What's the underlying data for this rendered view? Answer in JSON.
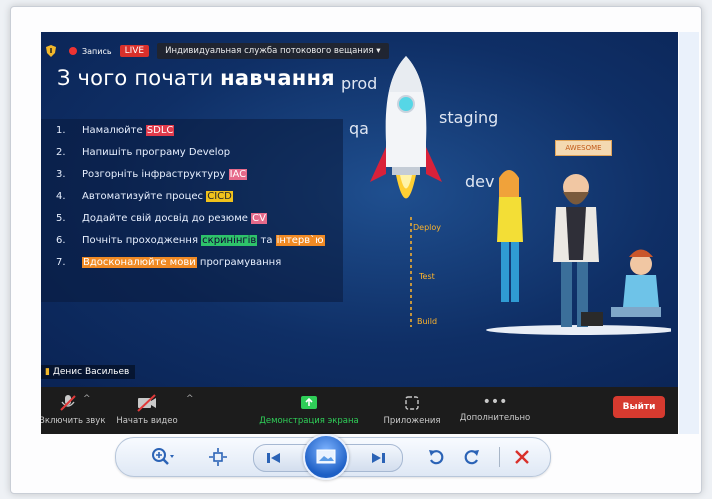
{
  "meeting": {
    "recording_label": "Запись",
    "live_label": "LIVE",
    "service_label": "Индивидуальная служба потокового вещания",
    "participant_name": "Денис Васильев"
  },
  "slide": {
    "title_plain": "З чого почати ",
    "title_bold": "навчання",
    "steps": [
      {
        "num": "1.",
        "parts": [
          {
            "t": "Намалюйте "
          },
          {
            "t": "SDLC",
            "hl": "red"
          }
        ]
      },
      {
        "num": "2.",
        "parts": [
          {
            "t": "Напишіть програму Develop"
          }
        ]
      },
      {
        "num": "3.",
        "parts": [
          {
            "t": "Розгорніть інфраструктуру "
          },
          {
            "t": "IAC",
            "hl": "pink"
          }
        ]
      },
      {
        "num": "4.",
        "parts": [
          {
            "t": "Автоматизуйте процес "
          },
          {
            "t": "CICD",
            "hl": "yellow"
          }
        ]
      },
      {
        "num": "5.",
        "parts": [
          {
            "t": "Додайте свій досвід до резюме "
          },
          {
            "t": "CV",
            "hl": "pink"
          }
        ]
      },
      {
        "num": "6.",
        "parts": [
          {
            "t": "Почніть проходження "
          },
          {
            "t": "скринінгів",
            "hl": "green"
          },
          {
            "t": " та "
          },
          {
            "t": "інтерв`ю",
            "hl": "orange"
          }
        ]
      },
      {
        "num": "7.",
        "parts": [
          {
            "t": "Вдосконалюйте мови",
            "hl": "orange"
          },
          {
            "t": " програмування"
          }
        ]
      }
    ],
    "stages": {
      "prod": "prod",
      "qa": "qa",
      "staging": "staging",
      "dev": "dev"
    },
    "pipeline": {
      "deploy": "Deploy",
      "test": "Test",
      "build": "Build"
    },
    "sign": "AWESOME"
  },
  "toolbar": {
    "mute": "Включить звук",
    "video": "Начать видео",
    "share": "Демонстрация экрана",
    "apps": "Приложения",
    "more": "Дополнительно",
    "leave": "Выйти"
  },
  "colors": {
    "leave": "#d63a2f",
    "share": "#2fce58",
    "live": "#d9302b"
  },
  "viewer_controls": {
    "icons": [
      "zoom-icon",
      "actual-size-icon",
      "previous-icon",
      "slideshow-icon",
      "next-icon",
      "rotate-left-icon",
      "rotate-right-icon",
      "delete-icon"
    ]
  }
}
